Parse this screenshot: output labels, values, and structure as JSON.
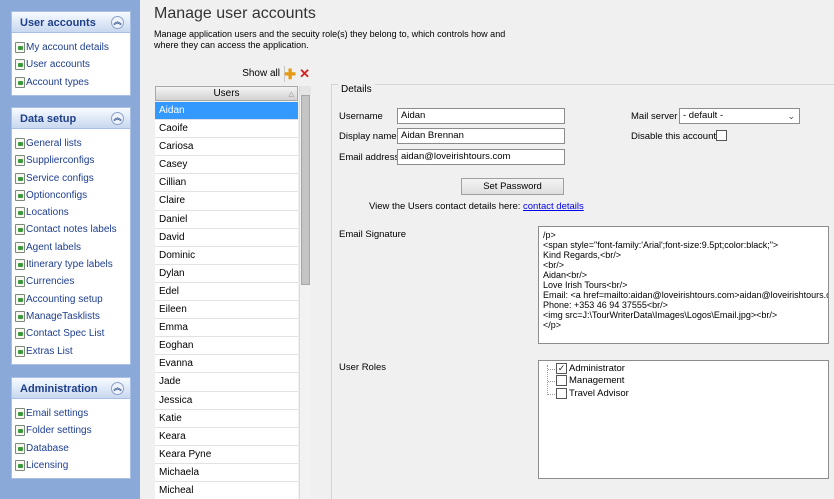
{
  "nav": {
    "groups": [
      {
        "title": "User accounts",
        "items": [
          "My account details",
          "User accounts",
          "Account types"
        ]
      },
      {
        "title": "Data setup",
        "items": [
          "General lists",
          "Supplierconfigs",
          "Service configs",
          "Optionconfigs",
          "Locations",
          "Contact notes labels",
          "Agent labels",
          "Itinerary type labels",
          "Currencies",
          "Accounting setup",
          "ManageTasklists",
          "Contact Spec List",
          "Extras List"
        ]
      },
      {
        "title": "Administration",
        "items": [
          "Email settings",
          "Folder settings",
          "Database",
          "Licensing"
        ]
      }
    ]
  },
  "page": {
    "title": "Manage user accounts",
    "description": "Manage application users and the secuity role(s) they belong to, which controls how and where they can access the application."
  },
  "users": {
    "show_all": "Show all",
    "header": "Users",
    "selected": "Aidan",
    "list": [
      "Aidan",
      "Caoife",
      "Cariosa",
      "Casey",
      "Cillian",
      "Claire",
      "Daniel",
      "David",
      "Dominic",
      "Dylan",
      "Edel",
      "Eileen",
      "Emma",
      "Eoghan",
      "Evanna",
      "Jade",
      "Jessica",
      "Katie",
      "Keara",
      "Keara Pyne",
      "Michaela",
      "Micheal"
    ]
  },
  "details": {
    "legend": "Details",
    "username_label": "Username",
    "username": "Aidan",
    "display_name_label": "Display name",
    "display_name": "Aidan Brennan",
    "email_label": "Email address",
    "email": "aidan@loveirishtours.com",
    "mail_server_label": "Mail server",
    "mail_server": "- default -",
    "disable_label": "Disable this account",
    "disabled": false,
    "set_password": "Set Password",
    "contact_prompt": "View the Users contact details here:",
    "contact_link": "contact details",
    "signature_label": "Email Signature",
    "signature_lines": [
      "/p>",
      "<span style=\"font-family:'Arial';font-size:9.5pt;color:black;\">",
      "Kind Regards,<br/>",
      "<br/>",
      "Aidan<br/>",
      "Love Irish Tours<br/>",
      "Email: <a href=mailto:aidan@loveirishtours.com>aidan@loveirishtours.com</a></br>",
      "Phone: +353 46 94 37555<br/>",
      "<img src=J:\\TourWriterData\\Images\\Logos\\Email.jpg><br/>",
      "</p>"
    ],
    "roles_label": "User Roles",
    "roles": [
      {
        "name": "Administrator",
        "checked": true
      },
      {
        "name": "Management",
        "checked": false
      },
      {
        "name": "Travel Advisor",
        "checked": false
      }
    ]
  }
}
